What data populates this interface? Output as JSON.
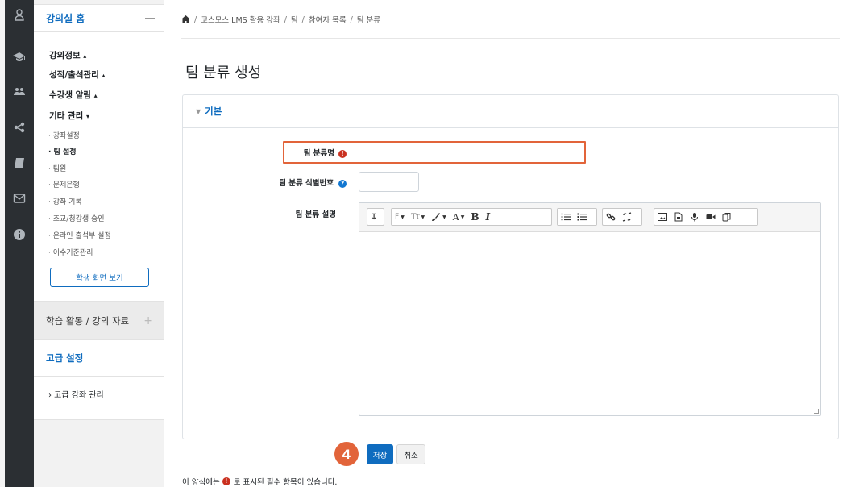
{
  "breadcrumb": {
    "items": [
      "코스모스 LMS 활용 강좌",
      "팀",
      "참여자 목록",
      "팀 분류"
    ],
    "separator": "/"
  },
  "sidebar": {
    "title": "강의실 홈",
    "groups": [
      {
        "label": "강의정보",
        "arrow": "▴"
      },
      {
        "label": "성적/출석관리",
        "arrow": "▴"
      },
      {
        "label": "수강생 알림",
        "arrow": "▴"
      },
      {
        "label": "기타 관리",
        "arrow": "▾"
      }
    ],
    "sub_items": [
      "· 강좌설정",
      "· 팀 설정",
      "· 팀원",
      "· 문제은행",
      "· 강좌 기록",
      "· 조교/청강생 승인",
      "· 온라인 출석부 설정",
      "· 이수기준관리"
    ],
    "active_sub": "· 팀 설정",
    "student_view_button": "학생 화면 보기",
    "section_activities": "학습 활동 / 강의 자료",
    "section_advanced": "고급 설정",
    "advanced_item": "›  고급 강좌 관리"
  },
  "page": {
    "title": "팀 분류 생성"
  },
  "form": {
    "section_label": "기본",
    "field_name_label": "팀 분류명",
    "field_name_value": "",
    "field_idnumber_label": "팀 분류 식별번호",
    "field_idnumber_value": "",
    "field_description_label": "팀 분류 설명",
    "required_icon": "!",
    "help_icon": "?",
    "save_button": "저장",
    "cancel_button": "취소",
    "required_note_before": "이 양식에는",
    "required_note_after": "로 표시된 필수 항목이 있습니다."
  },
  "annotation": {
    "step_number": "4",
    "accent_color": "#e2643a"
  },
  "colors": {
    "primary": "#0f6cbf",
    "required": "#ca3120",
    "help": "#1177d1",
    "rail": "#2b2f33"
  },
  "icons": {
    "rail": [
      "user-icon",
      "graduation-cap-icon",
      "users-icon",
      "share-icon",
      "book-icon",
      "mail-icon",
      "info-icon"
    ],
    "breadcrumb_home": "home-icon"
  }
}
